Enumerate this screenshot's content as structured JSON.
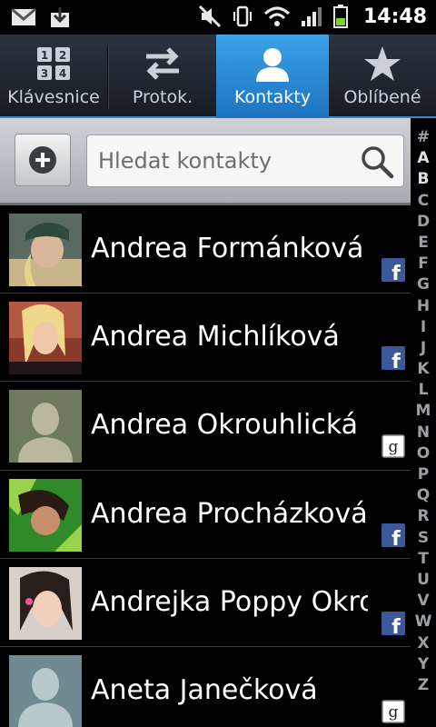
{
  "status_bar": {
    "time": "14:48",
    "icons": [
      "gmail-icon",
      "download-icon",
      "mute-icon",
      "vibrate-icon",
      "wifi-icon",
      "signal-icon",
      "battery-icon"
    ]
  },
  "tabs": [
    {
      "label": "Klávesnice",
      "icon": "keypad-icon",
      "selected": false
    },
    {
      "label": "Protok.",
      "icon": "call-log-icon",
      "selected": false
    },
    {
      "label": "Kontakty",
      "icon": "contact-icon",
      "selected": true
    },
    {
      "label": "Oblíbené",
      "icon": "star-icon",
      "selected": false
    }
  ],
  "search": {
    "placeholder": "Hledat kontakty",
    "value": ""
  },
  "index_letters": [
    "#",
    "A",
    "B",
    "C",
    "D",
    "E",
    "F",
    "G",
    "H",
    "I",
    "J",
    "K",
    "L",
    "M",
    "N",
    "O",
    "P",
    "Q",
    "R",
    "S",
    "T",
    "U",
    "V",
    "W",
    "X",
    "Y",
    "Z"
  ],
  "contacts": [
    {
      "name": "Andrea Formánková",
      "source": "facebook"
    },
    {
      "name": "Andrea Michlíková",
      "source": "facebook"
    },
    {
      "name": "Andrea Okrouhlická",
      "source": "google"
    },
    {
      "name": "Andrea Procházková",
      "source": "facebook"
    },
    {
      "name": "Andrejka Poppy Okrouhlická",
      "source": "facebook"
    },
    {
      "name": "Aneta Janečková",
      "source": "google"
    }
  ],
  "colors": {
    "accent": "#2a8ad8",
    "facebook": "#3b5998",
    "background": "#000000"
  },
  "source_glyphs": {
    "facebook": "f",
    "google": "g"
  }
}
